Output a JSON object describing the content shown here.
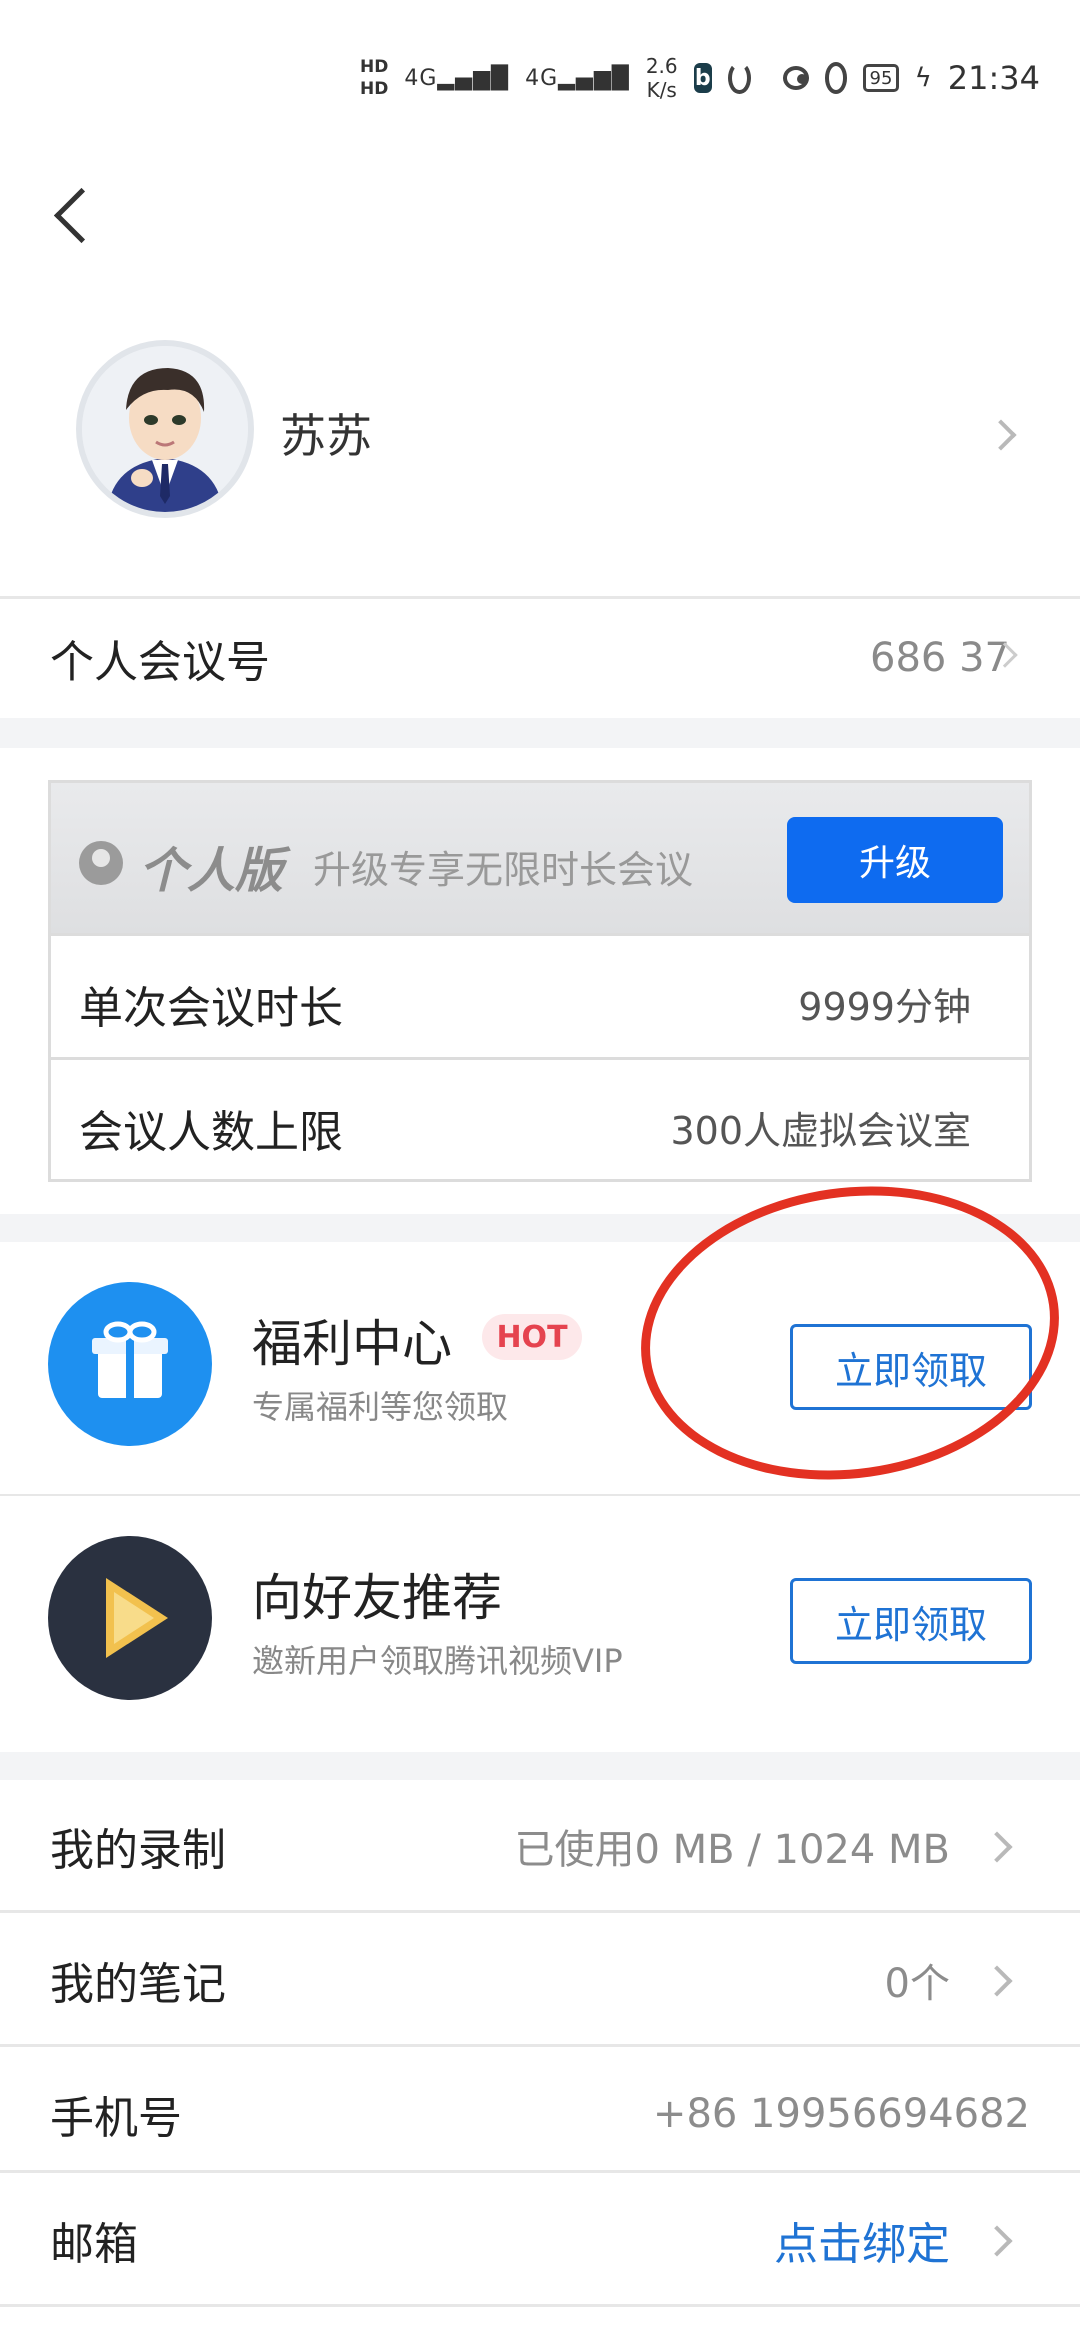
{
  "status_bar": {
    "hd1": "HD",
    "hd2": "HD",
    "signal1": "4G",
    "signal2": "4G",
    "rate_value": "2.6",
    "rate_unit": "K/s",
    "app_badge": "b",
    "battery": "95",
    "time": "21:34"
  },
  "profile": {
    "name": "苏苏"
  },
  "meeting_id": {
    "label": "个人会议号",
    "value": "686 37"
  },
  "plan": {
    "title": "个人版",
    "desc": "升级专享无限时长会议",
    "upgrade_label": "升级",
    "rows": [
      {
        "label": "单次会议时长",
        "value": "9999分钟"
      },
      {
        "label": "会议人数上限",
        "value": "300人虚拟会议室"
      }
    ]
  },
  "promos": [
    {
      "title": "福利中心",
      "badge": "HOT",
      "subtitle": "专属福利等您领取",
      "button": "立即领取"
    },
    {
      "title": "向好友推荐",
      "subtitle": "邀新用户领取腾讯视频VIP",
      "button": "立即领取"
    }
  ],
  "list": {
    "recording": {
      "label": "我的录制",
      "value": "已使用0 MB / 1024 MB"
    },
    "notes": {
      "label": "我的笔记",
      "value": "0个"
    },
    "phone": {
      "label": "手机号",
      "value": "+86 19956694682"
    },
    "email": {
      "label": "邮箱",
      "value": "点击绑定"
    }
  },
  "colors": {
    "accent": "#0e6bf0",
    "link": "#1f73d4",
    "hot": "#e5434f",
    "annotation": "#e33122"
  }
}
